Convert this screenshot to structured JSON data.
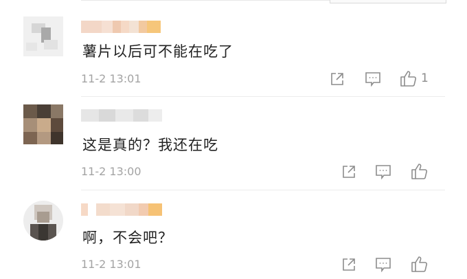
{
  "comments": [
    {
      "text": "薯片以后可不能在吃了",
      "time": "11-2 13:01",
      "likes": "1",
      "actions": {
        "share": "share-icon",
        "reply": "comment-icon",
        "like": "thumbs-up-icon"
      }
    },
    {
      "text": "这是真的？我还在吃",
      "time": "11-2 13:00",
      "likes": "",
      "actions": {
        "share": "share-icon",
        "reply": "comment-icon",
        "like": "thumbs-up-icon"
      }
    },
    {
      "text": "啊，不会吧？",
      "time": "11-2 13:01",
      "likes": "",
      "actions": {
        "share": "share-icon",
        "reply": "comment-icon",
        "like": "thumbs-up-icon"
      }
    }
  ],
  "colors": {
    "text": "#222222",
    "meta": "#a3a3a3",
    "icon": "#8c8c8c",
    "divider": "#ececec"
  }
}
